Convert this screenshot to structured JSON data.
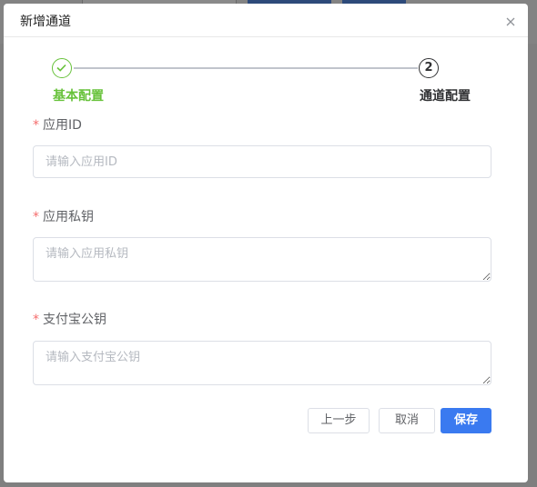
{
  "dialog": {
    "title": "新增通道"
  },
  "steps": [
    {
      "label": "基本配置",
      "status": "done"
    },
    {
      "label": "通道配置",
      "number": "2",
      "status": "current"
    }
  ],
  "fields": {
    "app_id": {
      "label": "应用ID",
      "placeholder": "请输入应用ID",
      "value": ""
    },
    "app_private_key": {
      "label": "应用私钥",
      "placeholder": "请输入应用私钥",
      "value": ""
    },
    "alipay_public_key": {
      "label": "支付宝公钥",
      "placeholder": "请输入支付宝公钥",
      "value": ""
    }
  },
  "buttons": {
    "prev": "上一步",
    "cancel": "取消",
    "save": "保存"
  },
  "required_mark": "*",
  "colors": {
    "success": "#67c23a",
    "primary": "#3a7af0",
    "required": "#f56c6c"
  }
}
